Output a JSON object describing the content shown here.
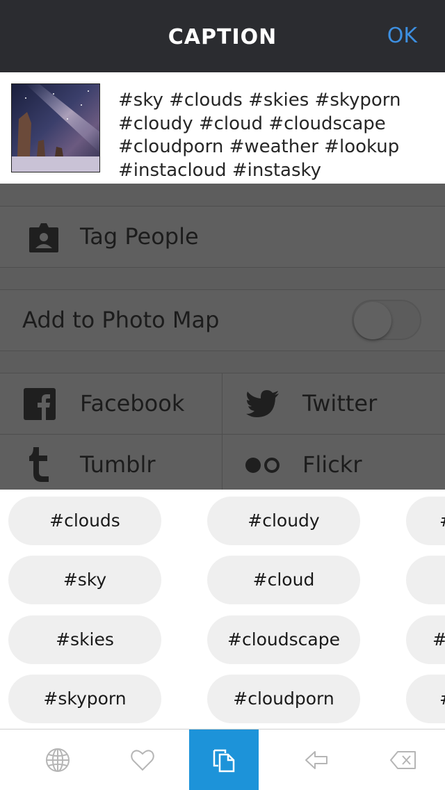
{
  "header": {
    "title": "CAPTION",
    "ok_label": "OK"
  },
  "caption": {
    "lines": [
      "#sky #clouds #skies #skyporn",
      "#cloudy #cloud #cloudscape",
      "#cloudporn #weather #lookup",
      "#instacloud #instasky"
    ]
  },
  "options": {
    "tag_people": "Tag People",
    "photo_map": "Add to Photo Map",
    "photo_map_on": false,
    "share": {
      "facebook": "Facebook",
      "twitter": "Twitter",
      "tumblr": "Tumblr",
      "flickr": "Flickr"
    }
  },
  "suggestions": {
    "col1": [
      "#clouds",
      "#sky",
      "#skies",
      "#skyporn"
    ],
    "col2": [
      "#cloudy",
      "#cloud",
      "#cloudscape",
      "#cloudporn"
    ],
    "col3": [
      "#",
      "",
      "#",
      "#"
    ]
  },
  "toolbar": {
    "icons": [
      "globe-icon",
      "heart-icon",
      "copy-icon",
      "back-arrow-icon",
      "delete-icon"
    ],
    "active_index": 2,
    "active_color": "#1d93d9"
  },
  "colors": {
    "header_bg": "#2b2c30",
    "ok": "#3d8fe0",
    "dim_overlay": "#5d5d5d",
    "chip_bg": "#efefef"
  }
}
